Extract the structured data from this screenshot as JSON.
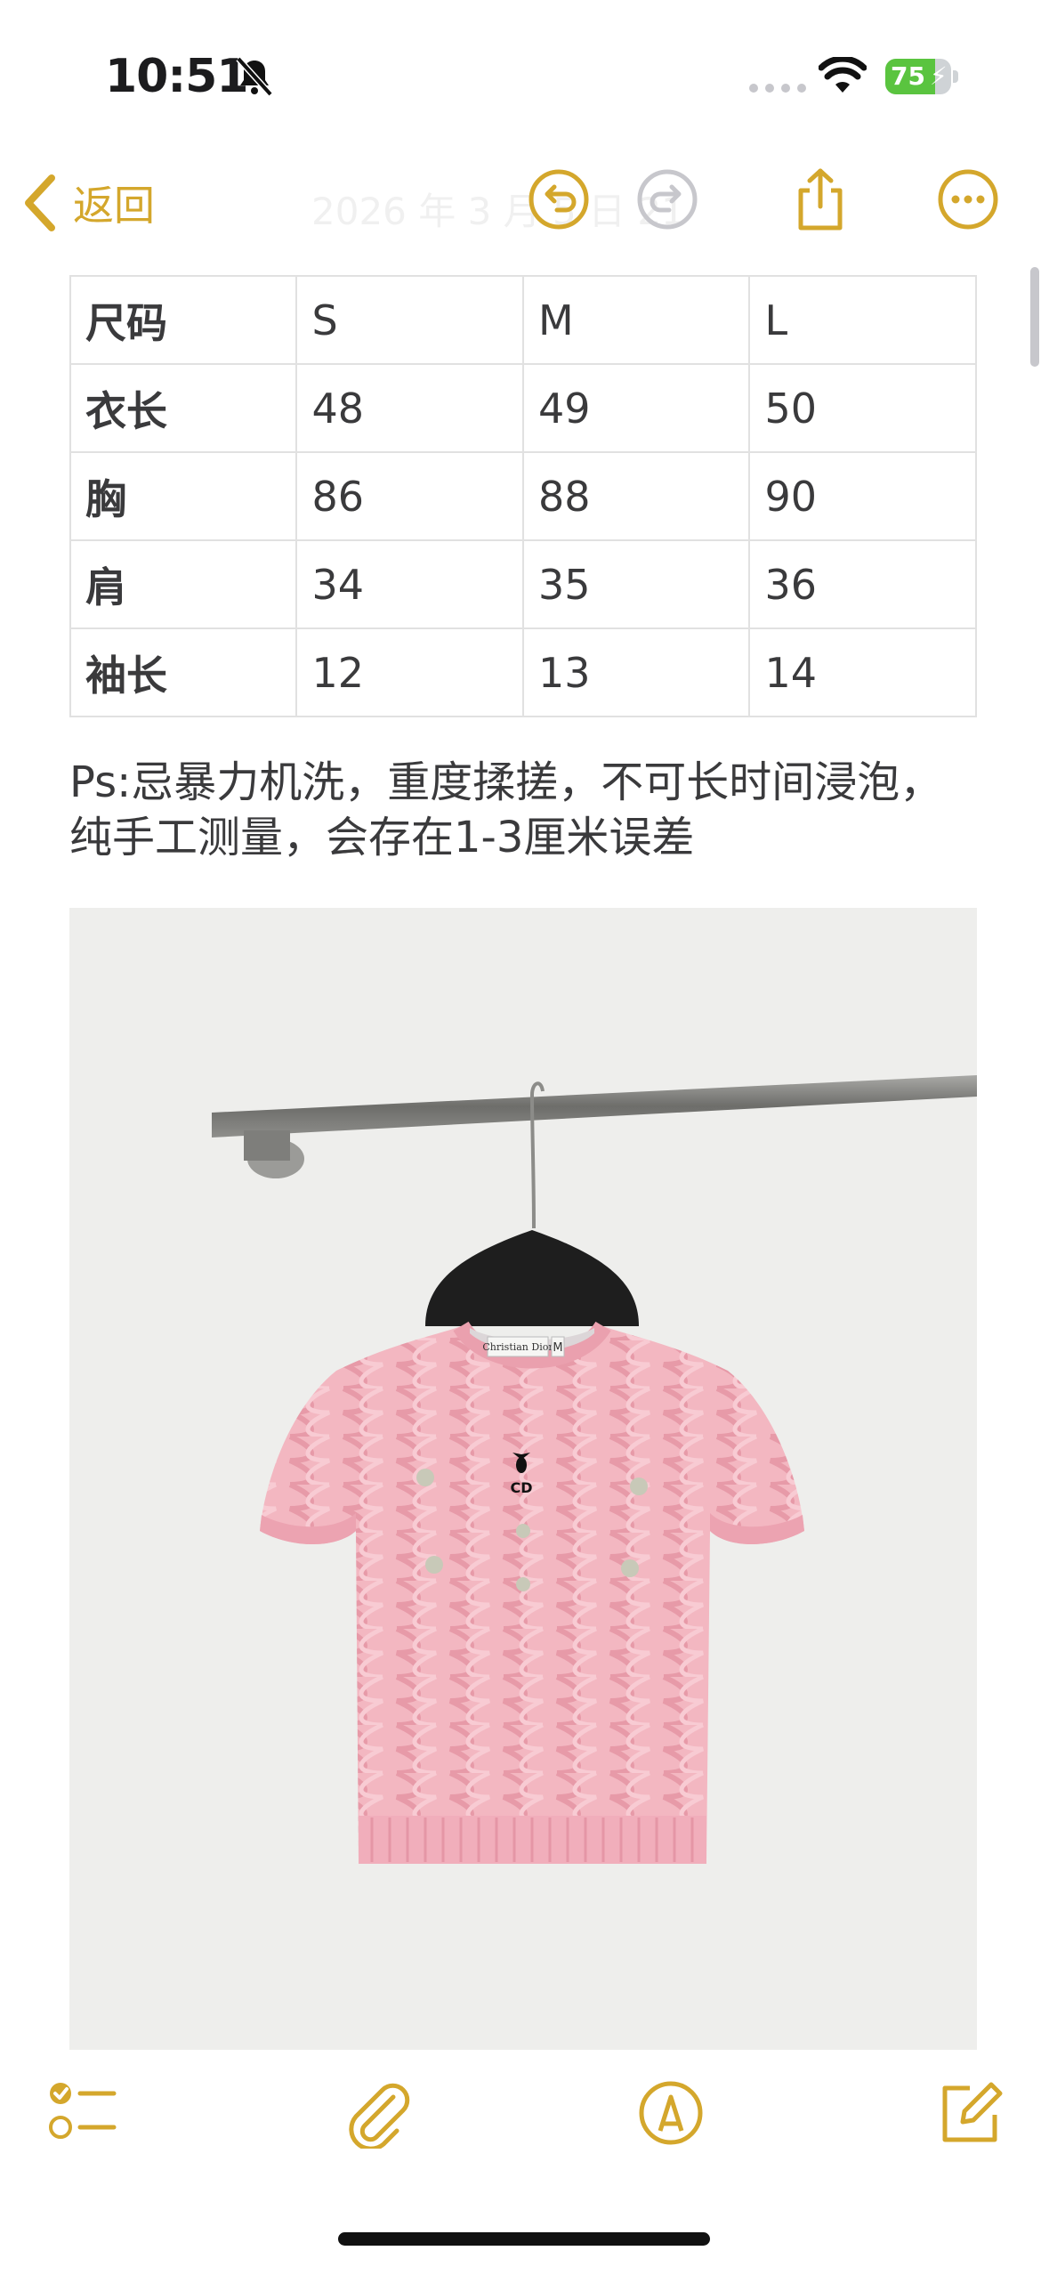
{
  "status_bar": {
    "time": "10:51",
    "battery_percent": "75",
    "battery_level": 0.75
  },
  "nav": {
    "back_label": "返回",
    "title": "2026 年 3 月 5 日 21"
  },
  "table": {
    "rows": [
      [
        "尺码",
        "S",
        "M",
        "L"
      ],
      [
        "衣长",
        "48",
        "49",
        "50"
      ],
      [
        "胸",
        "86",
        "88",
        "90"
      ],
      [
        "肩",
        "34",
        "35",
        "36"
      ],
      [
        "袖长",
        "12",
        "13",
        "14"
      ]
    ]
  },
  "note": {
    "line1": "Ps:忌暴力机洗，重度揉搓，不可长时间浸泡，",
    "line2": "纯手工测量，会存在1-3厘米误差"
  },
  "photo": {
    "label_text": "Christian Dior",
    "size_tag": "M",
    "monogram": "CD"
  },
  "colors": {
    "accent": "#d4a72c",
    "sweater": "#f3b7c1",
    "table_border": "#e1e1e1"
  },
  "icons": {
    "nav": [
      "chevron-left-icon",
      "undo-icon",
      "redo-icon",
      "share-icon",
      "more-icon"
    ],
    "toolbar": [
      "checklist-icon",
      "paperclip-icon",
      "markup-pen-icon",
      "compose-icon"
    ]
  }
}
